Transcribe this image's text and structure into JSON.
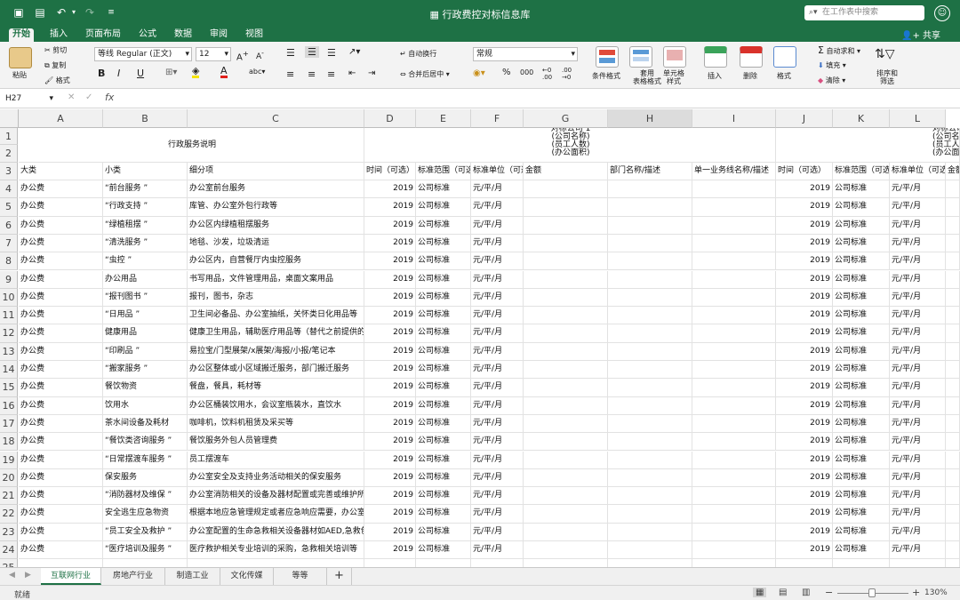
{
  "window": {
    "title": "行政费控对标信息库",
    "search_placeholder": "在工作表中搜索"
  },
  "ribbon_tabs": [
    "开始",
    "插入",
    "页面布局",
    "公式",
    "数据",
    "审阅",
    "视图"
  ],
  "share_label": "共享",
  "ribbon": {
    "paste": "粘贴",
    "cut": "剪切",
    "copy": "复制",
    "format_painter": "格式",
    "font_name": "等线 Regular (正文)",
    "font_size": "12",
    "bold": "B",
    "italic": "I",
    "underline": "U",
    "wrap_text": "自动换行",
    "merge_center": "合并后居中",
    "number_format": "常规",
    "percent": "%",
    "thousands": "000",
    "cond_format": "条件格式",
    "table_format_1": "套用",
    "table_format_2": "表格格式",
    "cell_style_1": "单元格",
    "cell_style_2": "样式",
    "insert": "插入",
    "delete": "删除",
    "format": "格式",
    "autosum": "自动求和",
    "fill": "填充",
    "clear": "清除",
    "sort_filter_1": "排序和",
    "sort_filter_2": "筛选"
  },
  "formula_bar": {
    "name_box": "H27",
    "fx": "fx",
    "value": ""
  },
  "columns": [
    "A",
    "B",
    "C",
    "D",
    "E",
    "F",
    "G",
    "H",
    "I",
    "J",
    "K",
    "L"
  ],
  "row_numbers": [
    "1",
    "2",
    "3",
    "4",
    "5",
    "6",
    "7",
    "8",
    "9",
    "10",
    "11",
    "12",
    "13",
    "14",
    "15",
    "16",
    "17",
    "18",
    "19",
    "20",
    "21",
    "22",
    "23",
    "24",
    "25"
  ],
  "merged": {
    "title": "行政服务说明",
    "company1_line1": "对标公司 1",
    "company1_line2": "(公司名称)",
    "company1_line3": "(员工人数)",
    "company1_line4": "(办公面积)",
    "company2_line1": "对标公司",
    "company2_line2": "(公司名称",
    "company2_line3": "(员工人数",
    "company2_line4": "(办公面积"
  },
  "headers": [
    "大类",
    "小类",
    "细分项",
    "时间（可选）",
    "标准范围（可选）",
    "标准单位（可选）",
    "金额",
    "部门名称/描述",
    "单一业务线名称/描述",
    "时间（可选）",
    "标准范围（可选）",
    "标准单位（可选）",
    "金额"
  ],
  "rows": [
    [
      "办公费",
      "“前台服务 ”",
      "办公室前台服务",
      "2019",
      "公司标准",
      "元/平/月"
    ],
    [
      "办公费",
      "“行政支持 ”",
      "库管、办公室外包行政等",
      "2019",
      "公司标准",
      "元/平/月"
    ],
    [
      "办公费",
      "“绿植租摆 ”",
      "办公区内绿植租摆服务",
      "2019",
      "公司标准",
      "元/平/月"
    ],
    [
      "办公费",
      "“清洗服务 ”",
      "地毯、沙发，垃圾清运",
      "2019",
      "公司标准",
      "元/平/月"
    ],
    [
      "办公费",
      "“虫控 ”",
      "办公区内，自营餐厅内虫控服务",
      "2019",
      "公司标准",
      "元/平/月"
    ],
    [
      "办公费",
      "办公用品",
      "书写用品，文件管理用品，桌面文案用品",
      "2019",
      "公司标准",
      "元/平/月"
    ],
    [
      "办公费",
      "“报刊图书 ”",
      "报刊，图书，杂志",
      "2019",
      "公司标准",
      "元/平/月"
    ],
    [
      "办公费",
      "“日用品 ”",
      "卫生间必备品、办公室抽纸，关怀类日化用品等",
      "2019",
      "公司标准",
      "元/平/月"
    ],
    [
      "办公费",
      "健康用品",
      "健康卫生用品，辅助医疗用品等（替代之前提供的",
      "2019",
      "公司标准",
      "元/平/月"
    ],
    [
      "办公费",
      "“印刷品 ”",
      "易拉宝/门型展架/x展架/海报/小报/笔记本",
      "2019",
      "公司标准",
      "元/平/月"
    ],
    [
      "办公费",
      "“搬家服务 ”",
      "办公区整体或小区域搬迁服务，部门搬迁服务",
      "2019",
      "公司标准",
      "元/平/月"
    ],
    [
      "办公费",
      "餐饮物资",
      "餐盘，餐具，耗材等",
      "2019",
      "公司标准",
      "元/平/月"
    ],
    [
      "办公费",
      "饮用水",
      "办公区桶装饮用水，会议室瓶装水，直饮水",
      "2019",
      "公司标准",
      "元/平/月"
    ],
    [
      "办公费",
      "茶水间设备及耗材",
      "咖啡机，饮料机租赁及采买等",
      "2019",
      "公司标准",
      "元/平/月"
    ],
    [
      "办公费",
      "“餐饮类咨询服务 ”",
      "餐饮服务外包人员管理费",
      "2019",
      "公司标准",
      "元/平/月"
    ],
    [
      "办公费",
      "“日常摆渡车服务 ”",
      "员工摆渡车",
      "2019",
      "公司标准",
      "元/平/月"
    ],
    [
      "办公费",
      "保安服务",
      "办公室安全及支持业务活动相关的保安服务",
      "2019",
      "公司标准",
      "元/平/月"
    ],
    [
      "办公费",
      "“消防器材及维保 ”",
      "办公室消防相关的设备及器材配置或完善或维护所",
      "2019",
      "公司标准",
      "元/平/月"
    ],
    [
      "办公费",
      "安全逃生应急物资",
      "根据本地应急管理规定或者应急响应需要，办公室",
      "2019",
      "公司标准",
      "元/平/月"
    ],
    [
      "办公费",
      "“员工安全及救护 ”",
      "办公室配置的生命急救相关设备器材如AED,急救包",
      "2019",
      "公司标准",
      "元/平/月"
    ],
    [
      "办公费",
      "“医疗培训及服务 ”",
      "医疗救护相关专业培训的采购，急救相关培训等",
      "2019",
      "公司标准",
      "元/平/月"
    ]
  ],
  "sheet_tabs": [
    "互联网行业",
    "房地产行业",
    "制造工业",
    "文化传媒",
    "等等"
  ],
  "status": {
    "ready": "就绪",
    "zoom": "130%"
  }
}
